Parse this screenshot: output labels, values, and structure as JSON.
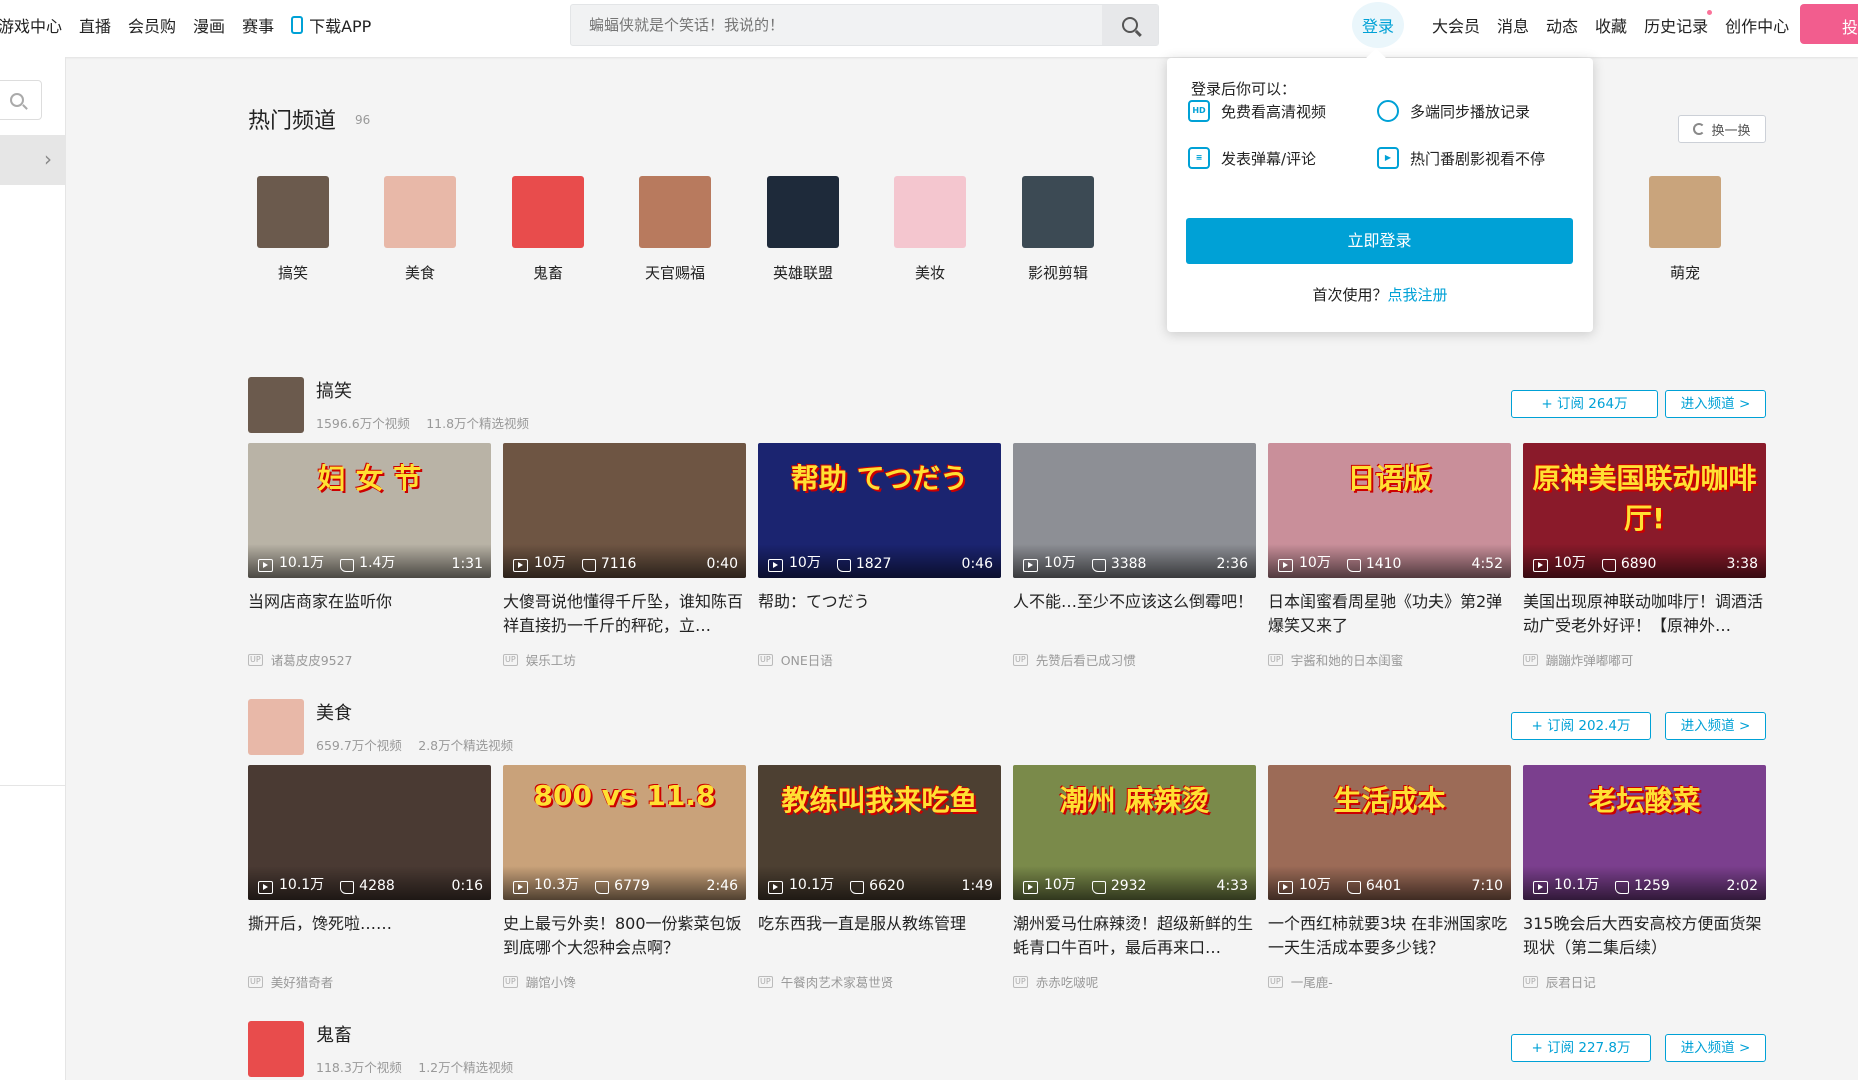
{
  "topnav": {
    "left": [
      "游戏中心",
      "直播",
      "会员购",
      "漫画",
      "赛事",
      "下载APP"
    ],
    "search_placeholder": "蝙蝠侠就是个笑话！我说的！",
    "login": "登录",
    "right": [
      "大会员",
      "消息",
      "动态",
      "收藏",
      "历史记录",
      "创作中心"
    ],
    "upload": "投"
  },
  "hot_channels": {
    "title": "热门频道",
    "count": "96",
    "refresh": "换一换",
    "items": [
      {
        "label": "搞笑",
        "color": "#6b5a4d"
      },
      {
        "label": "美食",
        "color": "#e8b8a8"
      },
      {
        "label": "鬼畜",
        "color": "#e84c4c"
      },
      {
        "label": "天官赐福",
        "color": "#b87a5e"
      },
      {
        "label": "英雄联盟",
        "color": "#1e2a3a"
      },
      {
        "label": "美妆",
        "color": "#f4c6cf"
      },
      {
        "label": "影视剪辑",
        "color": "#3c4a54"
      },
      {
        "label": "萌宠",
        "color": "#c9a47c"
      }
    ]
  },
  "login_popup": {
    "heading": "登录后你可以：",
    "features": [
      {
        "icon": "hd-icon",
        "text": "免费看高清视频"
      },
      {
        "icon": "clock-icon",
        "text": "多端同步播放记录"
      },
      {
        "icon": "danmaku-icon",
        "text": "发表弹幕/评论"
      },
      {
        "icon": "play-icon",
        "text": "热门番剧影视看不停"
      }
    ],
    "button": "立即登录",
    "footer_prefix": "首次使用？",
    "footer_link": "点我注册"
  },
  "sections": [
    {
      "name": "搞笑",
      "stats": "1596.6万个视频　 11.8万个精选视频",
      "subscribe": "+ 订阅 264万",
      "enter": "进入频道 >",
      "avatar_color": "#6b5a4d",
      "videos": [
        {
          "title": "当网店商家在监听你",
          "up": "诸葛皮皮9527",
          "views": "10.1万",
          "likes": "1.4万",
          "duration": "1:31",
          "color": "#b9b3a6",
          "caption": "妇 女 节"
        },
        {
          "title": "大傻哥说他懂得千斤坠，谁知陈百祥直接扔一千斤的秤砣，立…",
          "up": "娱乐工坊",
          "views": "10万",
          "likes": "7116",
          "duration": "0:40",
          "color": "#6e5543",
          "caption": ""
        },
        {
          "title": "帮助：てつだう",
          "up": "ONE日语",
          "views": "10万",
          "likes": "1827",
          "duration": "0:46",
          "color": "#1b2470",
          "caption": "帮助 てつだう"
        },
        {
          "title": "人不能…至少不应该这么倒霉吧！",
          "up": "先赞后看已成习惯",
          "views": "10万",
          "likes": "3388",
          "duration": "2:36",
          "color": "#8d8f95",
          "caption": ""
        },
        {
          "title": "日本闺蜜看周星驰《功夫》第2弹爆笑又来了",
          "up": "宇酱和她的日本闺蜜",
          "views": "10万",
          "likes": "1410",
          "duration": "4:52",
          "color": "#c98f9a",
          "caption": "日语版"
        },
        {
          "title": "美国出现原神联动咖啡厅！调酒活动广受老外好评！【原神外…",
          "up": "蹦蹦炸弹嘟嘟可",
          "views": "10万",
          "likes": "6890",
          "duration": "3:38",
          "color": "#8a1a2a",
          "caption": "原神美国联动咖啡厅!"
        }
      ]
    },
    {
      "name": "美食",
      "stats": "659.7万个视频　 2.8万个精选视频",
      "subscribe": "+ 订阅 202.4万",
      "enter": "进入频道 >",
      "avatar_color": "#e8b8a8",
      "videos": [
        {
          "title": "撕开后，馋死啦……",
          "up": "美好猎奇者",
          "views": "10.1万",
          "likes": "4288",
          "duration": "0:16",
          "color": "#4a3a33",
          "caption": ""
        },
        {
          "title": "史上最亏外卖！800一份紫菜包饭到底哪个大怨种会点啊？",
          "up": "蹦馆小馋",
          "views": "10.3万",
          "likes": "6779",
          "duration": "2:46",
          "color": "#c9a27a",
          "caption": "800 vs 11.8"
        },
        {
          "title": "吃东西我一直是服从教练管理",
          "up": "午餐肉艺术家葛世贤",
          "views": "10.1万",
          "likes": "6620",
          "duration": "1:49",
          "color": "#4d4032",
          "caption": "教练叫我来吃鱼"
        },
        {
          "title": "潮州爱马仕麻辣烫！超级新鲜的生蚝青口牛百叶，最后再来口…",
          "up": "赤赤吃啵呢",
          "views": "10万",
          "likes": "2932",
          "duration": "4:33",
          "color": "#7a8a4a",
          "caption": "潮州 麻辣烫"
        },
        {
          "title": "一个西红柿就要3块 在非洲国家吃一天生活成本要多少钱？",
          "up": "一尾鹿-",
          "views": "10万",
          "likes": "6401",
          "duration": "7:10",
          "color": "#9c6b57",
          "caption": "生活成本"
        },
        {
          "title": "315晚会后大西安高校方便面货架现状（第二集后续）",
          "up": "辰君日记",
          "views": "10.1万",
          "likes": "1259",
          "duration": "2:02",
          "color": "#7b3f8e",
          "caption": "老坛酸菜"
        }
      ]
    },
    {
      "name": "鬼畜",
      "stats": "118.3万个视频　 1.2万个精选视频",
      "subscribe": "+ 订阅 227.8万",
      "enter": "进入频道 >",
      "avatar_color": "#e84c4c",
      "videos": []
    }
  ]
}
